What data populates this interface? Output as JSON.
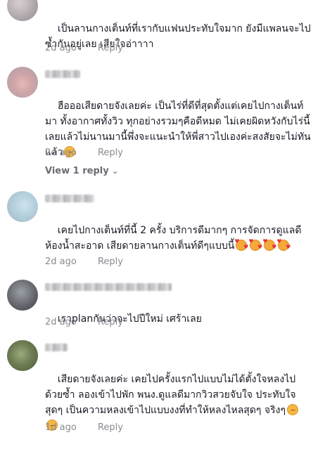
{
  "comments": [
    {
      "text": "เป็นลานกางเต็นท์ที่เรากับแฟนประทับใจมาก ยังมีแพลนจะไปซ้ำกันอยู่เลย เสียใจอ่าาาา",
      "date": "2d ago",
      "reply_label": "Reply"
    },
    {
      "text": "ฮือออเสียดายจังเลยค่ะ เป็นไร่ที่ดีที่สุดตั้งแต่เคยไปกางเต็นท์มา ทั้งอากาศทั้งวิว ทุกอย่างรวมๆคือดีหมด ไม่เคยผิดหวังกับไร่นี้เลยแล้วไม่นานมานี้พึ่งจะแนะนำให้พี่สาวไปเองค่ะสงสัยจะไม่ทันแล้ว",
      "emoji": [
        "sad-face-icon"
      ],
      "date": "2d ago",
      "reply_label": "Reply",
      "view_replies_label": "View 1 reply"
    },
    {
      "text": "เคยไปกางเต็นท์ที่นี้ 2 ครั้ง บริการดีมากๆ การจัดการดูแลดีห้องน้ำสะอาด เสียดายลานกางเต็นท์ดีๆแบบนี้",
      "emoji": [
        "love-face-icon",
        "love-face-icon",
        "love-face-icon",
        "love-face-icon"
      ],
      "date": "2d ago",
      "reply_label": "Reply"
    },
    {
      "text": "เราplanกันว่าจะไปปีใหม่ เศร้าเลย",
      "date": "2d ago",
      "reply_label": "Reply"
    },
    {
      "text": "เสียดายจังเลยค่ะ เคยไปครั้งแรกไปแบบไม่ได้ตั้งใจหลงไปด้วยซ้ำ ลองเข้าไปพัก พนง.ดูแลดีมากวิวสวยจับใจ ประทับใจสุดๆ เป็นความหลงเข้าไปแบบงงที่ทำให้หลงไหลสุดๆ จริงๆ",
      "emoji": [
        "sad-face-icon",
        "sad-face-icon"
      ],
      "date": "1d ago",
      "reply_label": "Reply"
    }
  ]
}
